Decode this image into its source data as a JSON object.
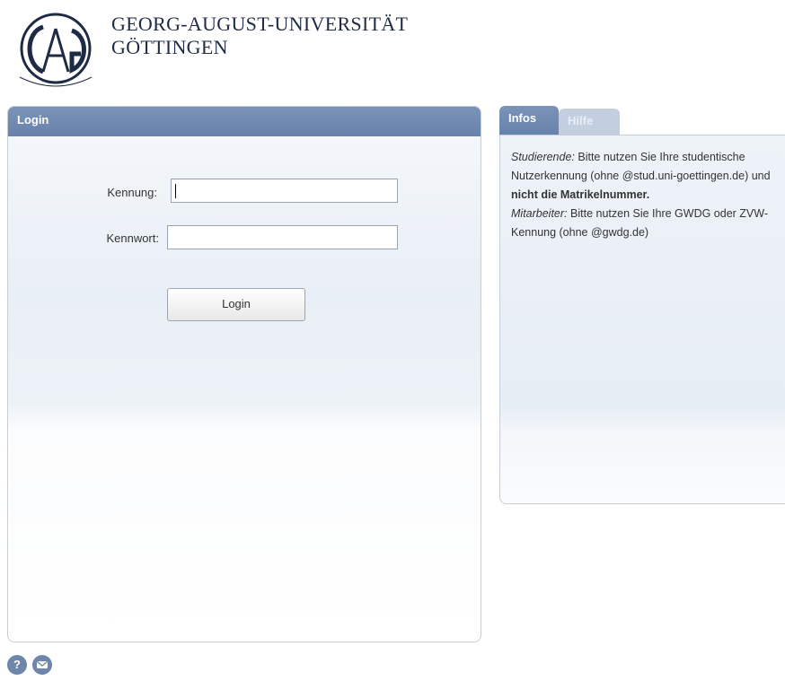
{
  "header": {
    "university_line1": "GEORG-AUGUST-UNIVERSITÄT",
    "university_line2": "GÖTTINGEN"
  },
  "login": {
    "title": "Login",
    "username_label": "Kennung:",
    "username_value": "",
    "password_label": "Kennwort:",
    "password_value": "",
    "button_label": "Login"
  },
  "info": {
    "tabs": [
      {
        "label": "Infos",
        "active": true
      },
      {
        "label": "Hilfe",
        "active": false
      }
    ],
    "students_prefix": "Studierende:",
    "students_text": " Bitte nutzen Sie Ihre studentische Nutzerkennung (ohne @stud.uni-goettingen.de) und ",
    "students_bold": "nicht die Matrikelnummer.",
    "staff_prefix": "Mitarbeiter:",
    "staff_text": " Bitte nutzen Sie Ihre GWDG oder ZVW-Kennung (ohne @gwdg.de)"
  },
  "footer": {
    "help_icon": "question-icon",
    "mail_icon": "envelope-icon"
  },
  "colors": {
    "header_blue": "#6f86ab",
    "inactive_tab": "#c3cfe0"
  }
}
